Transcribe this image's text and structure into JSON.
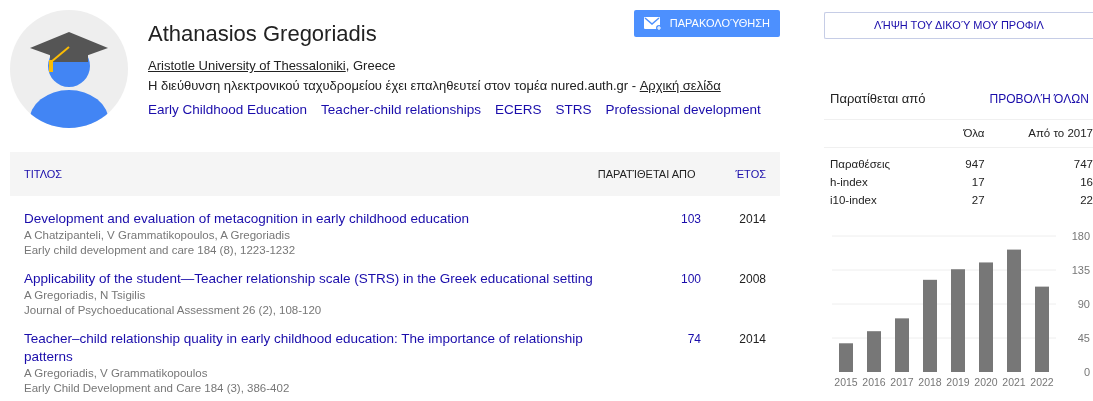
{
  "profile": {
    "name": "Athanasios Gregoriadis",
    "follow_button": "ΠΑΡΑΚΟΛΟΎΘΗΣΗ",
    "affiliation": {
      "link": "Aristotle University of Thessaloniki",
      "rest": ", Greece"
    },
    "email_note": {
      "text": "Η διεύθυνση ηλεκτρονικού ταχυδρομείου έχει επαληθευτεί στον τομέα nured.auth.gr - ",
      "link": "Αρχική σελίδα"
    },
    "interests": [
      "Early Childhood Education",
      "Teacher-child relationships",
      "ECERS",
      "STRS",
      "Professional development"
    ]
  },
  "articles": {
    "columns": [
      "ΤΙΤΛΟΣ",
      "ΠΑΡΑΤΊΘΕΤΑΙ ΑΠΟ",
      "ΈΤΟΣ"
    ],
    "rows": [
      {
        "title": "Development and evaluation of metacognition in early childhood education",
        "authors": "A Chatzipanteli, V Grammatikopoulos, A Gregoriadis",
        "venue": "Early child development and care 184 (8), 1223-1232",
        "cited_by": "103",
        "year": "2014"
      },
      {
        "title": "Applicability of the student—Teacher relationship scale (STRS) in the Greek educational setting",
        "authors": "A Gregoriadis, N Tsigilis",
        "venue": "Journal of Psychoeducational Assessment 26 (2), 108-120",
        "cited_by": "100",
        "year": "2008"
      },
      {
        "title": "Teacher–child relationship quality in early childhood education: The importance of relationship patterns",
        "authors": "A Gregoriadis, V Grammatikopoulos",
        "venue": "Early Child Development and Care 184 (3), 386-402",
        "cited_by": "74",
        "year": "2014"
      }
    ]
  },
  "sidebar": {
    "download_button": "ΛΉΨΗ ΤΟΥ ΔΙΚΟΎ ΜΟΥ ΠΡΟΦΙΛ",
    "cited_by": {
      "title": "Παρατίθεται από",
      "view_all": "ΠΡΟΒΟΛΉ ΌΛΩΝ",
      "columns": [
        "Όλα",
        "Από το 2017"
      ],
      "rows": [
        {
          "label": "Παραθέσεις",
          "all": "947",
          "since": "747"
        },
        {
          "label": "h-index",
          "all": "17",
          "since": "16"
        },
        {
          "label": "i10-index",
          "all": "27",
          "since": "22"
        }
      ]
    },
    "chart_data": {
      "type": "bar",
      "categories": [
        "2015",
        "2016",
        "2017",
        "2018",
        "2019",
        "2020",
        "2021",
        "2022"
      ],
      "grid": true,
      "series": [
        {
          "color": "#777777",
          "values": [
            38,
            54,
            71,
            122,
            136,
            145,
            162,
            113
          ]
        }
      ],
      "ylim": [
        0,
        180
      ],
      "yticks": [
        0,
        45,
        90,
        135,
        180
      ]
    }
  }
}
